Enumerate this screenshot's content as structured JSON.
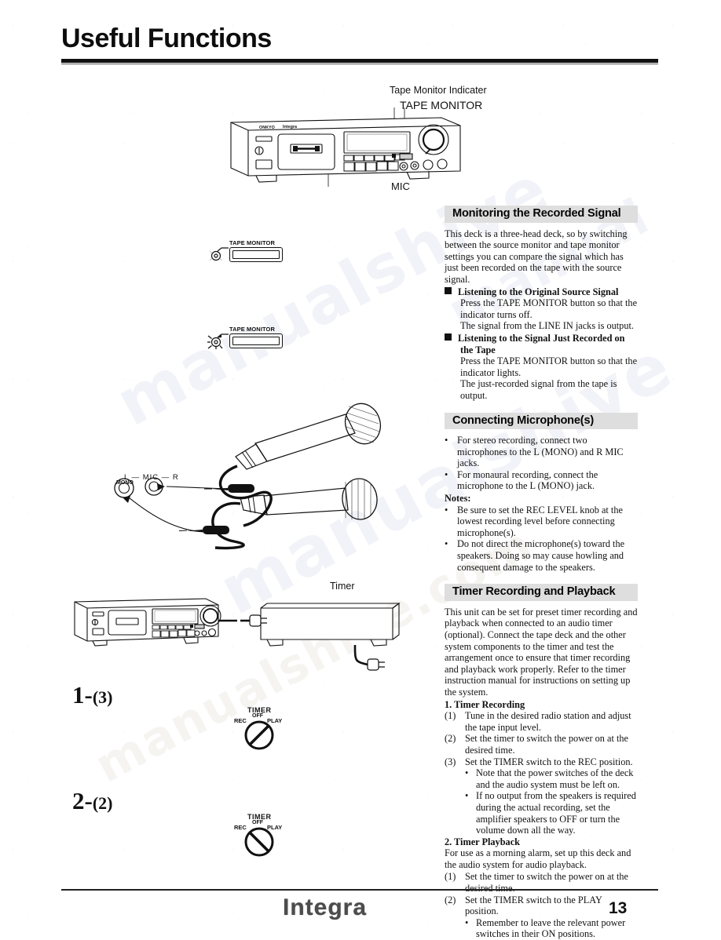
{
  "page": {
    "title": "Useful Functions",
    "brand": "Integra",
    "number": "13"
  },
  "top_diagram": {
    "label_indicator": "Tape Monitor Indicater",
    "label_tape_monitor": "TAPE MONITOR",
    "label_mic": "MIC",
    "deck_brand_left": "ONKYO",
    "deck_brand_right": "Integra"
  },
  "button_diagrams": [
    {
      "caption": "TAPE MONITOR",
      "state": "off"
    },
    {
      "caption": "TAPE MONITOR",
      "state": "lit"
    }
  ],
  "mic_jacks": {
    "row_label": "L — MIC — R",
    "mono_label": "MONO"
  },
  "timer_diagram": {
    "label": "Timer"
  },
  "steps": [
    {
      "big": "1",
      "dash": "-",
      "small": "(3)"
    },
    {
      "big": "2",
      "dash": "-",
      "small": "(2)"
    }
  ],
  "timer_switches": [
    {
      "title": "TIMER",
      "left": "REC",
      "center": "OFF",
      "right": "PLAY",
      "position": "rec"
    },
    {
      "title": "TIMER",
      "left": "REC",
      "center": "OFF",
      "right": "PLAY",
      "position": "play"
    }
  ],
  "sections": [
    {
      "heading": "Monitoring the Recorded Signal",
      "intro": "This deck is a three-head deck, so by switching between the source monitor and tape monitor settings you can compare the signal which has just been recorded on the tape with the source signal.",
      "subsections": [
        {
          "title": "Listening to the Original Source Signal",
          "lines": [
            "Press the TAPE MONITOR button so that the indicator turns off.",
            "The signal from the LINE IN jacks is output."
          ]
        },
        {
          "title": "Listening to the Signal Just Recorded on the Tape",
          "lines": [
            "Press the TAPE MONITOR button so that the indicator lights.",
            "The just-recorded signal from the tape is output."
          ]
        }
      ]
    },
    {
      "heading": "Connecting Microphone(s)",
      "bullets": [
        "For stereo recording, connect two microphones to the L (MONO) and R MIC jacks.",
        "For monaural recording, connect the microphone to the L (MONO) jack."
      ],
      "notes_label": "Notes:",
      "notes": [
        "Be sure to set the REC LEVEL knob at the lowest recording level before connecting microphone(s).",
        "Do not direct the microphone(s) toward the speakers. Doing so may cause howling and consequent damage to the speakers."
      ]
    },
    {
      "heading": "Timer Recording and Playback",
      "intro": "This unit can be set for preset timer recording and playback when connected to an audio timer (optional). Connect the tape deck and the other system components to the timer and test the arrangement once to ensure that timer recording and playback work properly. Refer to the timer instruction manual for instructions on setting up the system.",
      "group1_title": "1. Timer Recording",
      "group1_items": [
        {
          "n": "(1)",
          "text": "Tune in the desired radio station and adjust the tape input level."
        },
        {
          "n": "(2)",
          "text": "Set the timer to switch the power on at the desired time."
        },
        {
          "n": "(3)",
          "text": "Set the TIMER switch to the REC position."
        }
      ],
      "group1_notes": [
        "Note that the power switches of the deck and the audio system must be left on.",
        "If no output from the speakers is required during the actual recording, set the amplifier speakers to OFF or turn the volume down all the way."
      ],
      "group2_title": "2. Timer Playback",
      "group2_intro": "For use as a morning alarm, set up this deck and the audio system for audio playback.",
      "group2_items": [
        {
          "n": "(1)",
          "text": "Set the timer to switch the power on at the desired time."
        },
        {
          "n": "(2)",
          "text": "Set the TIMER switch to the PLAY position."
        }
      ],
      "group2_notes": [
        "Remember to leave the relevant power switches in their ON positions."
      ]
    }
  ]
}
